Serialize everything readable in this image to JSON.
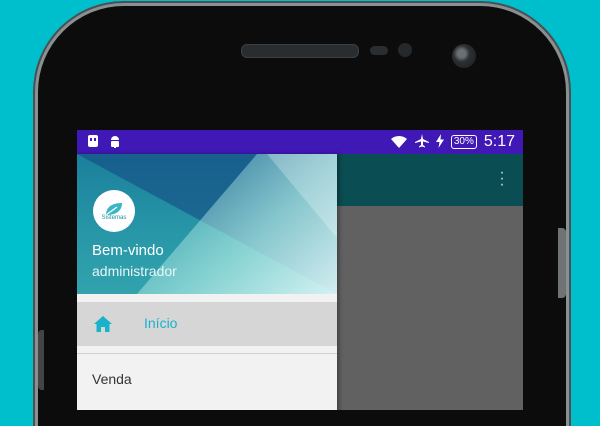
{
  "status_bar": {
    "left_icons": [
      "usb-icon",
      "android-icon"
    ],
    "right_icons": [
      "wifi-icon",
      "airplane-icon",
      "charging-icon"
    ],
    "battery": "30%",
    "time": "5:17"
  },
  "app_bar": {
    "overflow_icon": "more-vert-icon"
  },
  "drawer": {
    "avatar_text": "Sistemas",
    "welcome": "Bem-vindo",
    "username": "administrador",
    "items": [
      {
        "label": "Início",
        "icon": "home-icon",
        "active": true
      },
      {
        "label": "Venda"
      }
    ]
  },
  "colors": {
    "status_bar": "#3f18b5",
    "app_bar": "#0a4d52",
    "accent": "#19b2c9",
    "background": "#00bfcc"
  }
}
